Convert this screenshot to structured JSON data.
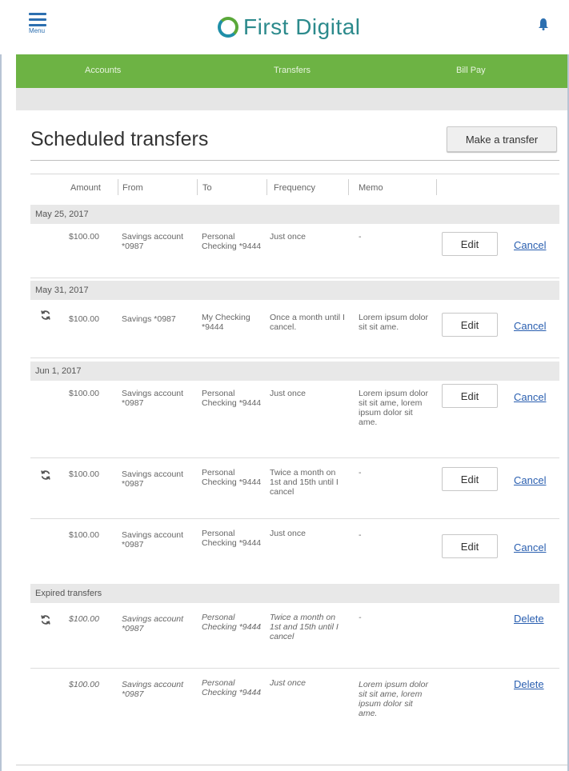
{
  "header": {
    "menu_label": "Menu",
    "brand": "First Digital",
    "colors": {
      "brand_green": "#6db344",
      "brand_teal": "#2c8a8c",
      "link_blue": "#2a5fb0"
    }
  },
  "nav": {
    "items": [
      {
        "label": "Accounts"
      },
      {
        "label": "Transfers"
      },
      {
        "label": "Bill Pay"
      }
    ]
  },
  "page": {
    "title": "Scheduled transfers",
    "make_transfer_label": "Make a transfer"
  },
  "table": {
    "columns": [
      "Amount",
      "From",
      "To",
      "Frequency",
      "Memo"
    ],
    "groups": [
      {
        "label": "May 25, 2017",
        "rows": [
          {
            "recurring": false,
            "amount": "$100.00",
            "from": "Savings account *0987",
            "to": "Personal Checking *9444",
            "frequency": "Just once",
            "memo": "-",
            "edit": "Edit",
            "action": "Cancel"
          }
        ]
      },
      {
        "label": "May 31, 2017",
        "rows": [
          {
            "recurring": true,
            "amount": "$100.00",
            "from": "Savings *0987",
            "to": "My Checking *9444",
            "frequency": "Once a month until I cancel.",
            "memo": "Lorem ipsum dolor sit sit ame.",
            "edit": "Edit",
            "action": "Cancel"
          }
        ]
      },
      {
        "label": "Jun 1, 2017",
        "rows": [
          {
            "recurring": false,
            "amount": "$100.00",
            "from": "Savings account *0987",
            "to": "Personal Checking *9444",
            "frequency": "Just once",
            "memo": "Lorem ipsum dolor sit sit ame, lorem ipsum dolor sit ame.",
            "edit": "Edit",
            "action": "Cancel"
          },
          {
            "recurring": true,
            "amount": "$100.00",
            "from": "Savings account *0987",
            "to": "Personal Checking *9444",
            "frequency": "Twice a month on 1st and 15th until I cancel",
            "memo": "-",
            "edit": "Edit",
            "action": "Cancel"
          },
          {
            "recurring": false,
            "amount": "$100.00",
            "from": "Savings account *0987",
            "to": "Personal Checking *9444",
            "frequency": "Just once",
            "memo": "-",
            "edit": "Edit",
            "action": "Cancel"
          }
        ]
      },
      {
        "label": "Expired transfers",
        "rows": [
          {
            "recurring": true,
            "amount": "$100.00",
            "from": "Savings account *0987",
            "to": "Personal Checking *9444",
            "frequency": "Twice a month on 1st and 15th until I cancel",
            "memo": "-",
            "action": "Delete"
          },
          {
            "recurring": false,
            "amount": "$100.00",
            "from": "Savings account *0987",
            "to": "Personal Checking *9444",
            "frequency": "Just once",
            "memo": "Lorem ipsum dolor sit sit ame, lorem ipsum dolor sit ame.",
            "action": "Delete"
          }
        ]
      }
    ]
  }
}
